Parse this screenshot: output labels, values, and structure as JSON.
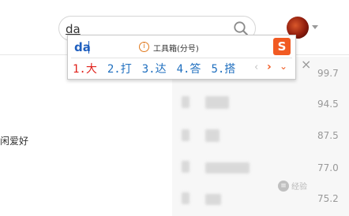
{
  "search": {
    "value": "da"
  },
  "ime": {
    "pinyin": "da",
    "toolbox_label": "工具箱(分号)",
    "logo_text": "S",
    "candidates": [
      "1.大",
      "2.打",
      "3.达",
      "4.答",
      "5.搭"
    ],
    "prev_glyph": "‹",
    "next_glyph": "›",
    "more_glyph": "⌄",
    "brand_color": "#f15a22"
  },
  "close_label": "×",
  "left_text": "闲爱好",
  "scores": [
    "99.7",
    "94.5",
    "87.5",
    "77.0",
    "75.2"
  ],
  "watermark": "经验"
}
